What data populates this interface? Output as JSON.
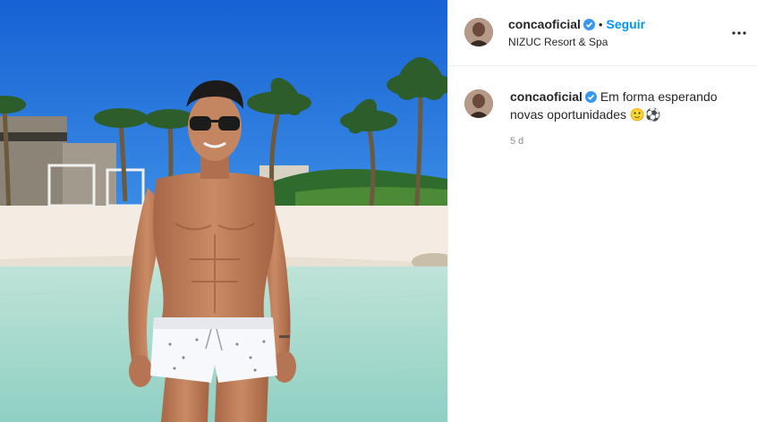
{
  "post": {
    "username": "concaoficial",
    "follow_label": "Seguir",
    "separator": "•",
    "location": "NIZUC Resort & Spa",
    "caption_line1": "Em forma esperando",
    "caption_line2": "novas oportunidades",
    "emojis": "🙂⚽",
    "time_ago": "5 d"
  },
  "icons": {
    "verified": "verified-badge-icon",
    "more": "more-options-icon"
  },
  "colors": {
    "follow": "#0095f6",
    "verified": "#3897f0",
    "text": "#262626",
    "muted": "#8e8e8e",
    "sky": "#1e6fd6"
  }
}
